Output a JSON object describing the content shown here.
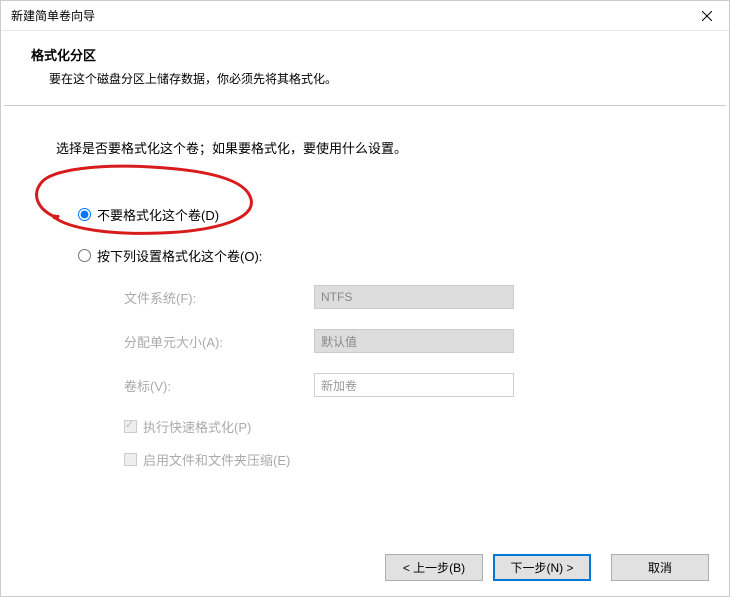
{
  "window": {
    "title": "新建简单卷向导"
  },
  "header": {
    "title": "格式化分区",
    "description": "要在这个磁盘分区上储存数据，你必须先将其格式化。"
  },
  "content": {
    "instruction": "选择是否要格式化这个卷；如果要格式化，要使用什么设置。",
    "radio_no_format": "不要格式化这个卷(D)",
    "radio_format": "按下列设置格式化这个卷(O):",
    "fields": {
      "filesystem_label": "文件系统(F):",
      "filesystem_value": "NTFS",
      "allocation_label": "分配单元大小(A):",
      "allocation_value": "默认值",
      "volume_label_label": "卷标(V):",
      "volume_label_value": "新加卷"
    },
    "checkboxes": {
      "quick_format": "执行快速格式化(P)",
      "compression": "启用文件和文件夹压缩(E)"
    }
  },
  "buttons": {
    "back": "< 上一步(B)",
    "next": "下一步(N) >",
    "cancel": "取消"
  }
}
